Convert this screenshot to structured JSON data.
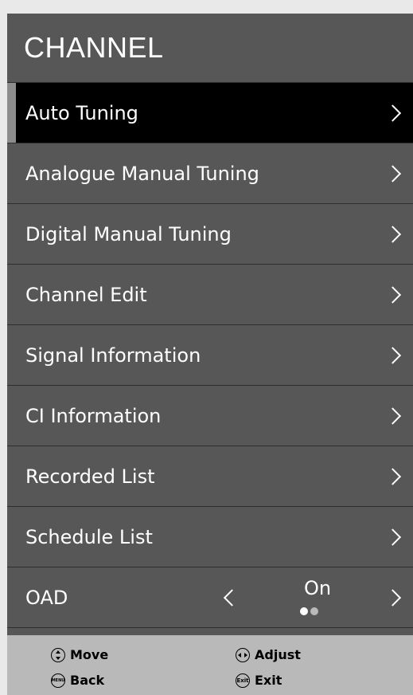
{
  "header": {
    "title": "CHANNEL"
  },
  "menu": [
    {
      "label": "Auto Tuning"
    },
    {
      "label": "Analogue Manual Tuning"
    },
    {
      "label": "Digital Manual Tuning"
    },
    {
      "label": "Channel Edit"
    },
    {
      "label": "Signal Information"
    },
    {
      "label": "CI Information"
    },
    {
      "label": "Recorded List"
    },
    {
      "label": "Schedule List"
    }
  ],
  "oad": {
    "label": "OAD",
    "value": "On",
    "option_index": 1,
    "option_count": 2
  },
  "footer": {
    "move_label": "Move",
    "adjust_label": "Adjust",
    "back_label": "Back",
    "back_icon_text": "MENU",
    "exit_label": "Exit",
    "exit_icon_text": "Exit"
  },
  "colors": {
    "panel": "#575757",
    "selected": "#000000",
    "footer": "#b9b9b9",
    "page": "#e9e9e9"
  }
}
